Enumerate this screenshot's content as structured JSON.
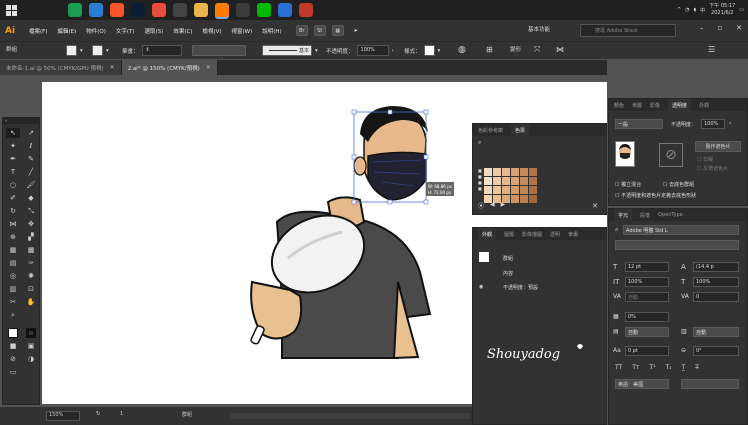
{
  "taskbar": {
    "clock_time": "下午 05:17",
    "clock_date": "2021/6/2",
    "apps": [
      {
        "icon": "search-icon",
        "color": "#202020"
      },
      {
        "icon": "task-view-icon",
        "color": "#202020"
      },
      {
        "icon": "chrome-icon",
        "color": "#1a9d55"
      },
      {
        "icon": "edge-icon",
        "color": "#2b7cd3"
      },
      {
        "icon": "brave-icon",
        "color": "#fb542b"
      },
      {
        "icon": "photoshop-icon",
        "color": "#0a1f35"
      },
      {
        "icon": "chrome-alt-icon",
        "color": "#e74c3c"
      },
      {
        "icon": "capture-icon",
        "color": "#444444"
      },
      {
        "icon": "folder-icon",
        "color": "#e8b64a"
      },
      {
        "icon": "illustrator-icon",
        "color": "#ff7c00"
      },
      {
        "icon": "calendar-icon",
        "color": "#3b3b3b"
      },
      {
        "icon": "line-icon",
        "color": "#00b900"
      },
      {
        "icon": "mail-icon",
        "color": "#2a6fd3"
      },
      {
        "icon": "media-icon",
        "color": "#c0392b"
      }
    ]
  },
  "menubar": {
    "logo": "Ai",
    "items": [
      "檔案(F)",
      "編輯(E)",
      "物件(O)",
      "文字(T)",
      "選取(S)",
      "效果(C)",
      "檢視(V)",
      "視窗(W)",
      "說明(H)"
    ],
    "workspace": "基本功能",
    "stock_placeholder": "搜尋 Adobe Stock"
  },
  "controlbar": {
    "selection_label": "群組",
    "stroke_label": "筆畫：",
    "brush_label": "基本",
    "opacity_label": "不透明度：",
    "opacity_value": "100%",
    "style_label": "樣式："
  },
  "tabs": [
    {
      "label": "未命名-1.ai @ 50% (CMYK/GPU 預視)",
      "active": false
    },
    {
      "label": "2.ai* @ 150% (CMYK/預視)",
      "active": true
    }
  ],
  "status": {
    "zoom": "150%",
    "page": "1",
    "selection_name": "群組"
  },
  "canvas": {
    "bbox_w": "W: 68.86 px",
    "bbox_h": "H: 72.04 px"
  },
  "swatches_panel": {
    "tabs": [
      "色彩參考庫",
      "色票"
    ],
    "active_tab": "色票",
    "colors": [
      [
        "#f3dcc6",
        "#eec9a6",
        "#e5b78f",
        "#d9a173",
        "#c98b5b",
        "#b37548"
      ],
      [
        "#f6e1cb",
        "#edcba7",
        "#e3b88c",
        "#d7a374",
        "#c58d5d",
        "#ad7648"
      ],
      [
        "#f4d7b7",
        "#ebc49a",
        "#e0b07f",
        "#d39c68",
        "#c08654",
        "#a97043"
      ],
      [
        "#f1d2ad",
        "#e7bd8f",
        "#dca876",
        "#cf9360",
        "#bb7d4c",
        "#a3673c"
      ]
    ]
  },
  "appearance_panel": {
    "tabs": [
      "外觀",
      "圖層",
      "影像描圖",
      "透明",
      "筆畫"
    ],
    "title": "群組",
    "content_label": "內容",
    "opacity_row": "不透明度：預設"
  },
  "signature": "Shouyadog",
  "color_panel": {
    "tabs": [
      "顏色",
      "漸層",
      "影像",
      "透明度",
      "外觀"
    ],
    "active_tab": "透明度",
    "blend_mode": "一般",
    "opacity_label": "不透明度：",
    "opacity_value": "100%",
    "make_mask_label": "製作遮色片",
    "clip_label": "剪裁",
    "invert_label": "反轉遮色片",
    "isolate_label": "獨立混合",
    "knockout_label": "去底色群組",
    "opacity_mask_label": "不透明度和遮色片定義去底色形狀"
  },
  "character_panel": {
    "tabs": [
      "字元",
      "段落",
      "OpenType"
    ],
    "font_family": "Adobe 明體 Std L",
    "font_size": "12 pt",
    "leading": "(14.4 p",
    "vscale": "100%",
    "hscale": "100%",
    "auto_label": "自動",
    "tracking": "0",
    "tsume": "0%",
    "auto1": "自動",
    "auto2": "自動",
    "baseline": "0 pt",
    "rotation": "0°",
    "language": "英語：美國"
  }
}
